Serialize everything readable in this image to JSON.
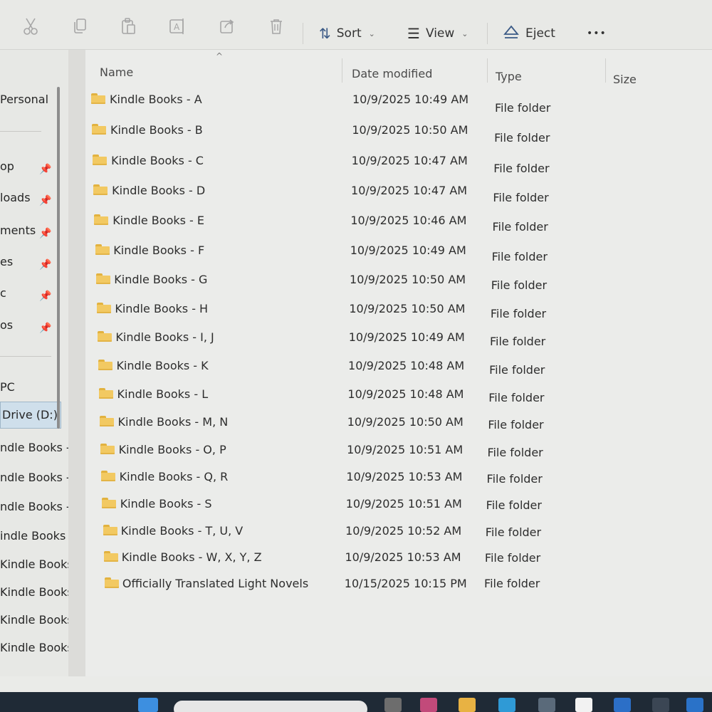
{
  "toolbar": {
    "icons": [
      "cut-icon",
      "copy-icon",
      "paste-icon",
      "rename-icon",
      "share-icon",
      "delete-icon"
    ],
    "sort_label": "Sort",
    "view_label": "View",
    "eject_label": "Eject",
    "more_label": "•••"
  },
  "sidebar": {
    "personal": "Personal",
    "pinned": [
      {
        "label": "op"
      },
      {
        "label": "loads"
      },
      {
        "label": "ments"
      },
      {
        "label": "es"
      },
      {
        "label": "c"
      },
      {
        "label": "os"
      }
    ],
    "pc": "PC",
    "drive": "Drive (D:)",
    "subitems": [
      "ndle Books -",
      "ndle Books -",
      "ndle Books -",
      "indle Books -",
      "Kindle Books -",
      "Kindle Books -",
      "Kindle Books -",
      "Kindle Books -"
    ]
  },
  "columns": {
    "name": "Name",
    "date": "Date modified",
    "type": "Type",
    "size": "Size"
  },
  "files": [
    {
      "name": "Kindle Books - A",
      "date": "10/9/2025 10:49 AM",
      "type": "File folder"
    },
    {
      "name": "Kindle Books - B",
      "date": "10/9/2025 10:50 AM",
      "type": "File folder"
    },
    {
      "name": "Kindle Books - C",
      "date": "10/9/2025 10:47 AM",
      "type": "File folder"
    },
    {
      "name": "Kindle Books - D",
      "date": "10/9/2025 10:47 AM",
      "type": "File folder"
    },
    {
      "name": "Kindle Books - E",
      "date": "10/9/2025 10:46 AM",
      "type": "File folder"
    },
    {
      "name": "Kindle Books - F",
      "date": "10/9/2025 10:49 AM",
      "type": "File folder"
    },
    {
      "name": "Kindle Books - G",
      "date": "10/9/2025 10:50 AM",
      "type": "File folder"
    },
    {
      "name": "Kindle Books - H",
      "date": "10/9/2025 10:50 AM",
      "type": "File folder"
    },
    {
      "name": "Kindle Books - I, J",
      "date": "10/9/2025 10:49 AM",
      "type": "File folder"
    },
    {
      "name": "Kindle Books - K",
      "date": "10/9/2025 10:48 AM",
      "type": "File folder"
    },
    {
      "name": "Kindle Books - L",
      "date": "10/9/2025 10:48 AM",
      "type": "File folder"
    },
    {
      "name": "Kindle Books - M, N",
      "date": "10/9/2025 10:50 AM",
      "type": "File folder"
    },
    {
      "name": "Kindle Books - O, P",
      "date": "10/9/2025 10:51 AM",
      "type": "File folder"
    },
    {
      "name": "Kindle Books - Q, R",
      "date": "10/9/2025 10:53 AM",
      "type": "File folder"
    },
    {
      "name": "Kindle Books - S",
      "date": "10/9/2025 10:51 AM",
      "type": "File folder"
    },
    {
      "name": "Kindle Books - T, U, V",
      "date": "10/9/2025 10:52 AM",
      "type": "File folder"
    },
    {
      "name": "Kindle Books - W, X, Y, Z",
      "date": "10/9/2025 10:53 AM",
      "type": "File folder"
    },
    {
      "name": "Officially Translated Light Novels",
      "date": "10/15/2025 10:15 PM",
      "type": "File folder"
    }
  ]
}
